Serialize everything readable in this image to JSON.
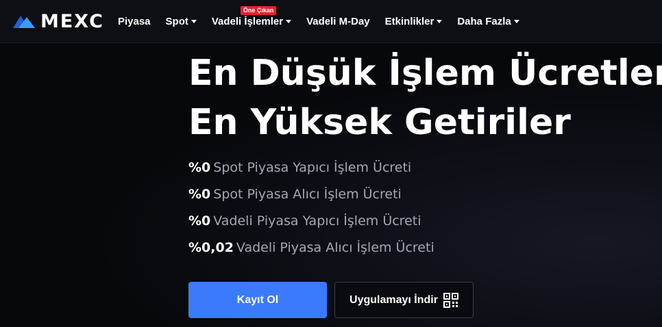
{
  "brand": {
    "name": "MEXC",
    "logo_icon": "mexc-mountain-logo",
    "logo_color_a": "#1f5fe0",
    "logo_color_b": "#3b9cff"
  },
  "nav": {
    "items": [
      {
        "label": "Piyasa",
        "has_caret": false,
        "badge": ""
      },
      {
        "label": "Spot",
        "has_caret": true,
        "badge": ""
      },
      {
        "label": "Vadeli İşlemler",
        "has_caret": true,
        "badge": "Öne Çıkan"
      },
      {
        "label": "Vadeli M-Day",
        "has_caret": false,
        "badge": ""
      },
      {
        "label": "Etkinlikler",
        "has_caret": true,
        "badge": ""
      },
      {
        "label": "Daha Fazla",
        "has_caret": true,
        "badge": ""
      }
    ],
    "caret_icon": "caret-down-icon",
    "badge_color": "#e8222d"
  },
  "hero": {
    "headline_line1": "En Düşük İşlem Ücretleri",
    "headline_line2": "En Yüksek Getiriler",
    "features": [
      {
        "percent": "%0",
        "text": "Spot Piyasa Yapıcı İşlem Ücreti"
      },
      {
        "percent": "%0",
        "text": "Spot Piyasa Alıcı İşlem Ücreti"
      },
      {
        "percent": "%0",
        "text": "Vadeli Piyasa Yapıcı İşlem Ücreti"
      },
      {
        "percent": "%0,02",
        "text": "Vadeli Piyasa Alıcı İşlem Ücreti"
      }
    ],
    "register_label": "Kayıt Ol",
    "download_label": "Uygulamayı İndir",
    "download_icon": "qr-code-icon",
    "accent_color": "#3b7bfb"
  }
}
